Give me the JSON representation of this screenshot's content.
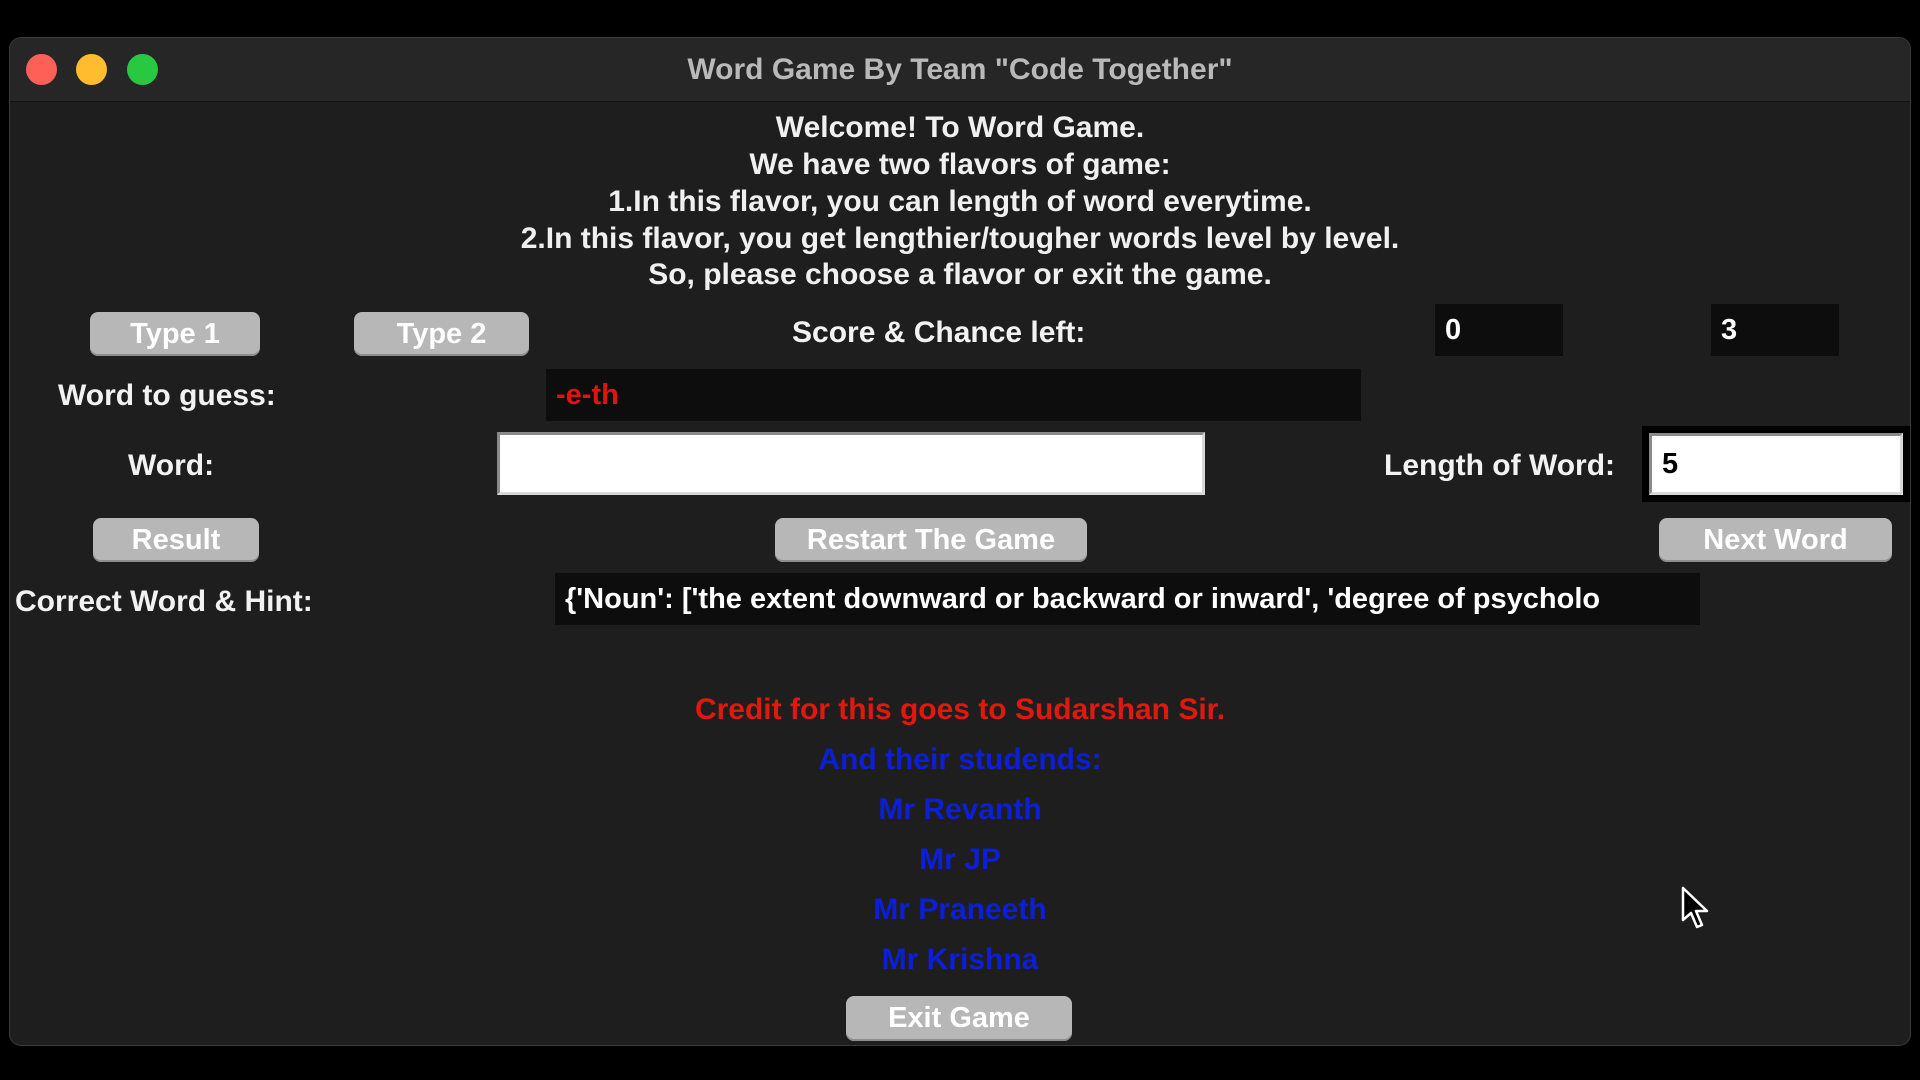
{
  "window": {
    "title": "Word Game By Team \"Code Together\""
  },
  "welcome_lines": [
    "Welcome! To Word Game.",
    "We have two flavors of game:",
    "1.In this flavor, you can length of word everytime.",
    "2.In this flavor, you get lengthier/tougher words level by level.",
    "So, please choose a flavor or exit the game."
  ],
  "buttons": {
    "type1": "Type 1",
    "type2": "Type 2",
    "result": "Result",
    "restart": "Restart The Game",
    "next_word": "Next Word",
    "exit": "Exit Game"
  },
  "score": {
    "label": "Score & Chance left:",
    "score": "0",
    "chances": "3"
  },
  "guess": {
    "label": "Word to guess:",
    "value": "-e-th"
  },
  "word_input": {
    "label": "Word:",
    "value": ""
  },
  "length": {
    "label": "Length of Word:",
    "value": "5"
  },
  "hint": {
    "label": "Correct Word & Hint:",
    "value": "{'Noun': ['the extent downward or backward or inward', 'degree of psycholo"
  },
  "credits": {
    "line1": "Credit for this goes to Sudarshan Sir.",
    "line2": "And their studends:",
    "students": [
      "Mr Revanth",
      "Mr JP",
      "Mr Praneeth",
      "Mr Krishna"
    ]
  },
  "colors": {
    "credit_red": "#e0180e",
    "credit_blue": "#0c1fd6",
    "guess_red": "#e31212",
    "traffic_red": "#fe5f57",
    "traffic_yellow": "#febc2e",
    "traffic_green": "#28c840"
  },
  "icons": {
    "cursor": "mouse-pointer-icon"
  }
}
